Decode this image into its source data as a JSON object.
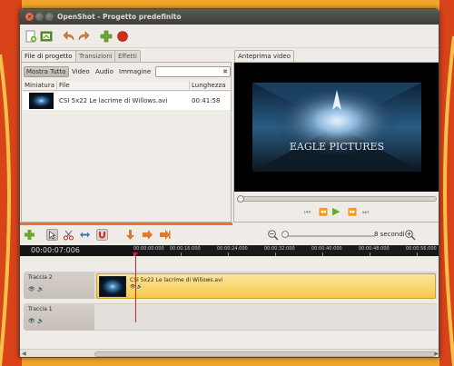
{
  "window": {
    "title": "OpenShot - Progetto predefinito"
  },
  "left_tabs": [
    {
      "label": "File di progetto"
    },
    {
      "label": "Transizioni"
    },
    {
      "label": "Effetti"
    }
  ],
  "filters": [
    {
      "label": "Mostra Tutto"
    },
    {
      "label": "Video"
    },
    {
      "label": "Audio"
    },
    {
      "label": "Immagine"
    }
  ],
  "search": {
    "value": "",
    "clear_icon": "✖"
  },
  "file_list": {
    "columns": [
      "Miniatura",
      "File",
      "Lunghezza"
    ],
    "rows": [
      {
        "file": "CSI 5x22 Le lacrime di Willows.avi",
        "length": "00:41:58"
      }
    ]
  },
  "preview": {
    "tab_label": "Anteprima video",
    "video_text": "EAGLE PICTURES",
    "seek_position": 0,
    "controls": [
      "skip-back-icon",
      "rewind-icon",
      "play-icon",
      "fast-forward-icon",
      "skip-forward-icon"
    ]
  },
  "timeline": {
    "zoom_label": "8 secondi",
    "zoom_level": 0.05,
    "current_time": "00:00:07:006",
    "ruler_labels": [
      "00:00:00:000",
      "00:00:16:000",
      "00:00:24:000",
      "00:00:32:000",
      "00:00:40:000",
      "00:00:48:000",
      "00:00:56:000"
    ],
    "tracks": [
      {
        "name": "Traccia 2",
        "clip": "CSI 5x22 Le lacrime di Willows.avi"
      },
      {
        "name": "Traccia 1",
        "clip": ""
      }
    ]
  },
  "colors": {
    "accent_orange": "#e8742d",
    "clip_yellow": "#f6c94a",
    "playhead_red": "#e02020",
    "play_green": "#6aa82a"
  }
}
